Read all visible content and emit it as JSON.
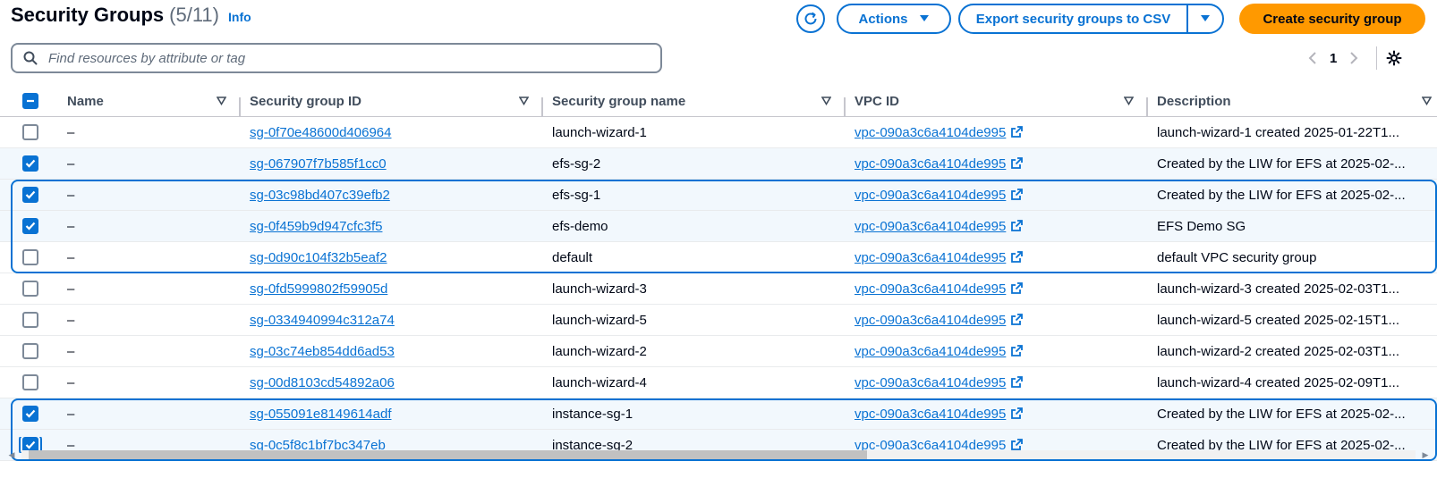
{
  "header": {
    "title": "Security Groups",
    "count": "(5/11)",
    "info": "Info",
    "actions_label": "Actions",
    "export_label": "Export security groups to CSV",
    "create_label": "Create security group"
  },
  "search": {
    "placeholder": "Find resources by attribute or tag",
    "value": ""
  },
  "pagination": {
    "current_page": "1"
  },
  "columns": [
    "Name",
    "Security group ID",
    "Security group name",
    "VPC ID",
    "Description"
  ],
  "rows": [
    {
      "selected": false,
      "name": "–",
      "sg_id": "sg-0f70e48600d406964",
      "sg_name": "launch-wizard-1",
      "vpc_id": "vpc-090a3c6a4104de995",
      "description": "launch-wizard-1 created 2025-01-22T1..."
    },
    {
      "selected": true,
      "name": "–",
      "sg_id": "sg-067907f7b585f1cc0",
      "sg_name": "efs-sg-2",
      "vpc_id": "vpc-090a3c6a4104de995",
      "description": "Created by the LIW for EFS at 2025-02-..."
    },
    {
      "selected": true,
      "name": "–",
      "sg_id": "sg-03c98bd407c39efb2",
      "sg_name": "efs-sg-1",
      "vpc_id": "vpc-090a3c6a4104de995",
      "description": "Created by the LIW for EFS at 2025-02-..."
    },
    {
      "selected": true,
      "name": "–",
      "sg_id": "sg-0f459b9d947cfc3f5",
      "sg_name": "efs-demo",
      "vpc_id": "vpc-090a3c6a4104de995",
      "description": "EFS Demo SG"
    },
    {
      "selected": false,
      "name": "–",
      "sg_id": "sg-0d90c104f32b5eaf2",
      "sg_name": "default",
      "vpc_id": "vpc-090a3c6a4104de995",
      "description": "default VPC security group"
    },
    {
      "selected": false,
      "name": "–",
      "sg_id": "sg-0fd5999802f59905d",
      "sg_name": "launch-wizard-3",
      "vpc_id": "vpc-090a3c6a4104de995",
      "description": "launch-wizard-3 created 2025-02-03T1..."
    },
    {
      "selected": false,
      "name": "–",
      "sg_id": "sg-0334940994c312a74",
      "sg_name": "launch-wizard-5",
      "vpc_id": "vpc-090a3c6a4104de995",
      "description": "launch-wizard-5 created 2025-02-15T1..."
    },
    {
      "selected": false,
      "name": "–",
      "sg_id": "sg-03c74eb854dd6ad53",
      "sg_name": "launch-wizard-2",
      "vpc_id": "vpc-090a3c6a4104de995",
      "description": "launch-wizard-2 created 2025-02-03T1..."
    },
    {
      "selected": false,
      "name": "–",
      "sg_id": "sg-00d8103cd54892a06",
      "sg_name": "launch-wizard-4",
      "vpc_id": "vpc-090a3c6a4104de995",
      "description": "launch-wizard-4 created 2025-02-09T1..."
    },
    {
      "selected": true,
      "name": "–",
      "sg_id": "sg-055091e8149614adf",
      "sg_name": "instance-sg-1",
      "vpc_id": "vpc-090a3c6a4104de995",
      "description": "Created by the LIW for EFS at 2025-02-..."
    },
    {
      "selected": true,
      "name": "–",
      "sg_id": "sg-0c5f8c1bf7bc347eb",
      "sg_name": "instance-sg-2",
      "vpc_id": "vpc-090a3c6a4104de995",
      "description": "Created by the LIW for EFS at 2025-02-..."
    }
  ],
  "icons": {
    "refresh": "refresh-icon",
    "caret": "caret-down-icon",
    "search": "search-icon",
    "external": "external-link-icon",
    "settings": "gear-icon",
    "sort": "sort-icon"
  },
  "colors": {
    "accent": "#0972d3",
    "primary_button": "#ff9900",
    "selected_row": "#f2f8fd"
  }
}
